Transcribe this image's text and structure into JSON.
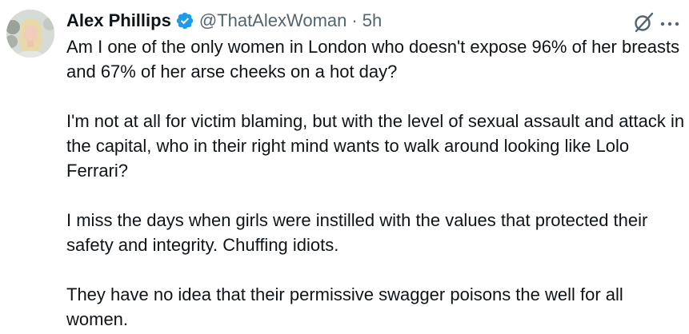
{
  "author": {
    "display_name": "Alex Phillips",
    "handle": "@ThatAlexWoman",
    "separator": "·",
    "time": "5h"
  },
  "tweet": {
    "paragraphs": [
      "Am I one of the only women in London who doesn't expose 96% of her breasts and 67% of her arse cheeks on a hot day?",
      "I'm not at all for victim blaming, but with the level of sexual assault and attack in the capital, who in their right mind wants to walk around looking like Lolo Ferrari?",
      "I miss the days when girls were instilled with the values that protected their safety and integrity. Chuffing idiots.",
      "They have no idea that their permissive swagger poisons the well for all women."
    ]
  },
  "icons": {
    "verified": "verified-badge-icon",
    "grok": "grok-icon",
    "more": "more-options-icon"
  },
  "colors": {
    "text": "#0f1419",
    "secondary": "#536471",
    "verified_blue": "#1d9bf0"
  }
}
